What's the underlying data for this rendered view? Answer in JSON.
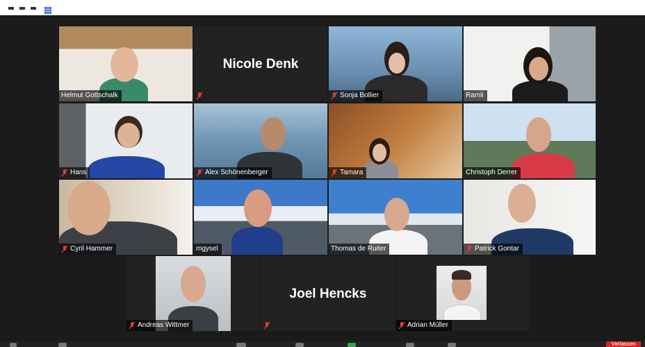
{
  "top_toolbar": {
    "icons": [
      "minus-icon",
      "minus-icon",
      "minus-icon",
      "gallery-grid-icon"
    ]
  },
  "gallery": {
    "active_speaker": "Helmut Gottschalk",
    "participants": [
      {
        "name": "Helmut Gottschalk",
        "video": true
      },
      {
        "name": "Nicole Denk",
        "video": false
      },
      {
        "name": "Sonja Bollier",
        "video": true
      },
      {
        "name": "Ramli",
        "video": true
      },
      {
        "name": "Hans",
        "video": true
      },
      {
        "name": "Alex Schönenberger",
        "video": true
      },
      {
        "name": "Tamara",
        "video": true
      },
      {
        "name": "Christoph Derrer",
        "video": true
      },
      {
        "name": "Cyril Hammer",
        "video": true
      },
      {
        "name": "mgysel",
        "video": true
      },
      {
        "name": "Thomas de Ruiter",
        "video": true
      },
      {
        "name": "Patrick Gontar",
        "video": true
      },
      {
        "name": "Andreas Wittmer",
        "video": true
      },
      {
        "name": "Joel Hencks",
        "video": false
      },
      {
        "name": "Adrian Müller",
        "video": true
      }
    ]
  },
  "bottom_toolbar": {
    "leave_label": "Verlassen",
    "colors": {
      "leave": "#d42424",
      "active_border": "#c9e04a"
    }
  }
}
